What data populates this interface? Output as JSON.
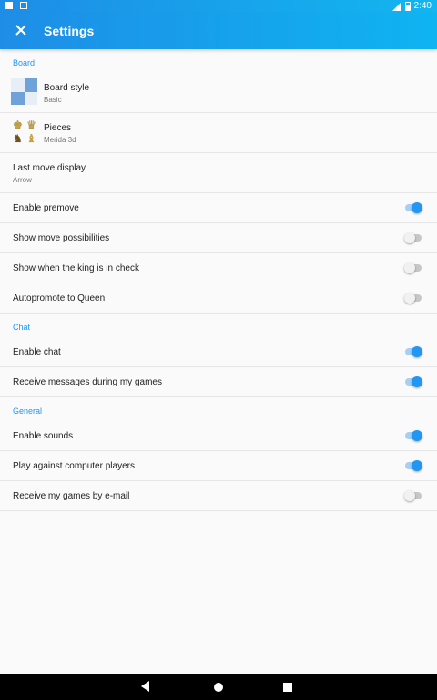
{
  "status_bar": {
    "time": "2:40"
  },
  "app_bar": {
    "title": "Settings",
    "nav_icon": "close-icon"
  },
  "sections": {
    "board": {
      "header": "Board",
      "board_style": {
        "title": "Board style",
        "summary": "Basic"
      },
      "pieces": {
        "title": "Pieces",
        "summary": "Merida 3d"
      },
      "last_move": {
        "title": "Last move display",
        "summary": "Arrow"
      },
      "premove": {
        "title": "Enable premove",
        "enabled": true
      },
      "move_possibilities": {
        "title": "Show move possibilities",
        "enabled": false
      },
      "king_in_check": {
        "title": "Show when the king is in check",
        "enabled": false
      },
      "autopromote": {
        "title": "Autopromote to Queen",
        "enabled": false
      }
    },
    "chat": {
      "header": "Chat",
      "enable_chat": {
        "title": "Enable chat",
        "enabled": true
      },
      "receive_messages": {
        "title": "Receive messages during my games",
        "enabled": true
      }
    },
    "general": {
      "header": "General",
      "enable_sounds": {
        "title": "Enable sounds",
        "enabled": true
      },
      "play_computer": {
        "title": "Play against computer players",
        "enabled": true
      },
      "email_games": {
        "title": "Receive my games by e-mail",
        "enabled": false
      }
    }
  },
  "colors": {
    "accent": "#2196f3",
    "app_bar_start": "#1e8de6",
    "app_bar_end": "#0fb4f1"
  },
  "nav_bar": {
    "icons": [
      "back-icon",
      "home-icon",
      "recents-icon"
    ]
  }
}
